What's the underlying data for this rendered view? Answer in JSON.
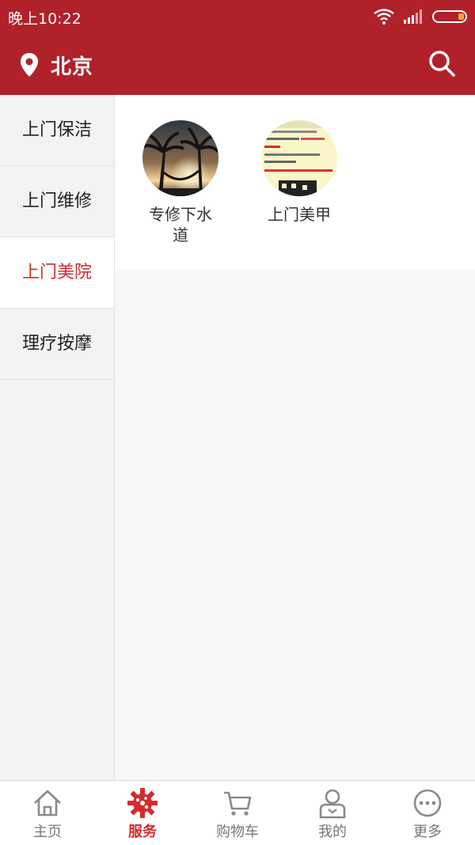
{
  "status_bar": {
    "time": "晚上10:22"
  },
  "header": {
    "city": "北京",
    "icons": {
      "location": "location-pin-icon",
      "search": "search-icon"
    }
  },
  "sidebar": {
    "items": [
      {
        "label": "上门保洁",
        "active": false
      },
      {
        "label": "上门维修",
        "active": false
      },
      {
        "label": "上门美院",
        "active": true
      },
      {
        "label": "理疗按摩",
        "active": false
      }
    ]
  },
  "services": [
    {
      "label": "专修下水道",
      "image": "palm-tree-sunset-hammock-image"
    },
    {
      "label": "上门美甲",
      "image": "document-screenshot-thumbnail-image"
    }
  ],
  "tabbar": {
    "tabs": [
      {
        "label": "主页",
        "icon": "home-icon",
        "active": false
      },
      {
        "label": "服务",
        "icon": "service-gear-icon",
        "active": true
      },
      {
        "label": "购物车",
        "icon": "cart-icon",
        "active": false
      },
      {
        "label": "我的",
        "icon": "profile-icon",
        "active": false
      },
      {
        "label": "更多",
        "icon": "more-icon",
        "active": false
      }
    ]
  },
  "colors": {
    "brand": "#b0212a",
    "accent": "#d32b2b",
    "inactive": "#777777"
  }
}
